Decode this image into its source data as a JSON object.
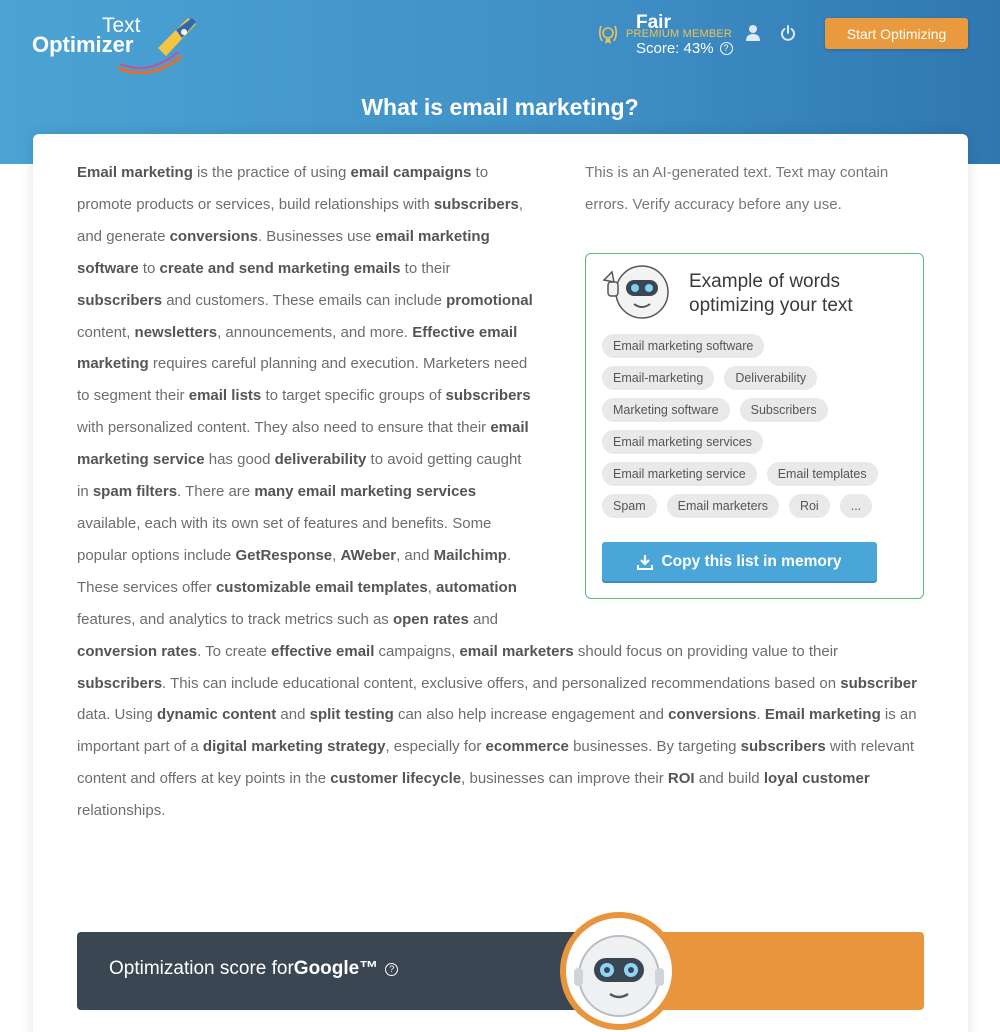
{
  "brand": {
    "logo_line1": "Text",
    "logo_line2": "Optimizer"
  },
  "header": {
    "premium_label": "PREMIUM MEMBER",
    "icons": [
      "medal-icon",
      "user-icon",
      "power-icon"
    ],
    "start_button": "Start Optimizing"
  },
  "page_title": "What is email marketing?",
  "disclaimer": "This is an AI-generated text. Text may contain errors. Verify accuracy before any use.",
  "article": {
    "segments": [
      {
        "t": "Email marketing",
        "b": true
      },
      {
        "t": " is the practice of using "
      },
      {
        "t": "email campaigns",
        "b": true
      },
      {
        "t": " to promote products or services, build relationships with "
      },
      {
        "t": "subscribers",
        "b": true
      },
      {
        "t": ", and generate "
      },
      {
        "t": "conversions",
        "b": true
      },
      {
        "t": ". Businesses use "
      },
      {
        "t": "email marketing software",
        "b": true
      },
      {
        "t": " to "
      },
      {
        "t": "create and send marketing emails",
        "b": true
      },
      {
        "t": " to their "
      },
      {
        "t": "subscribers",
        "b": true
      },
      {
        "t": " and customers. These emails can include "
      },
      {
        "t": "promotional",
        "b": true
      },
      {
        "t": " content, "
      },
      {
        "t": "newsletters",
        "b": true
      },
      {
        "t": ", announcements, and more. "
      },
      {
        "t": "Effective email marketing",
        "b": true
      },
      {
        "t": " requires careful planning and execution. Marketers need to segment their "
      },
      {
        "t": "email lists",
        "b": true
      },
      {
        "t": " to target specific groups of "
      },
      {
        "t": "subscribers",
        "b": true
      },
      {
        "t": " with personalized content. They also need to ensure that their "
      },
      {
        "t": "email marketing service",
        "b": true
      },
      {
        "t": " has good "
      },
      {
        "t": "deliverability",
        "b": true
      },
      {
        "t": " to avoid getting caught in "
      },
      {
        "t": "spam filters",
        "b": true
      },
      {
        "t": ". There are "
      },
      {
        "t": "many email marketing services",
        "b": true
      },
      {
        "t": " available, each with its own set of features and benefits. Some popular options include "
      },
      {
        "t": "GetResponse",
        "b": true
      },
      {
        "t": ", "
      },
      {
        "t": "AWeber",
        "b": true
      },
      {
        "t": ", and "
      },
      {
        "t": "Mailchimp",
        "b": true
      },
      {
        "t": ". These services offer "
      },
      {
        "t": "customizable email templates",
        "b": true
      },
      {
        "t": ", "
      },
      {
        "t": "automation",
        "b": true
      },
      {
        "t": " features, and analytics to track metrics such as "
      },
      {
        "t": "open rates",
        "b": true
      },
      {
        "t": " and "
      },
      {
        "t": "conversion rates",
        "b": true
      },
      {
        "t": ". To create "
      },
      {
        "t": "effective email",
        "b": true
      },
      {
        "t": " campaigns, "
      },
      {
        "t": "email marketers",
        "b": true
      },
      {
        "t": " should focus on providing value to their "
      },
      {
        "t": "subscribers",
        "b": true
      },
      {
        "t": ". This can include educational content, exclusive offers, and personalized recommendations based on "
      },
      {
        "t": "subscriber",
        "b": true
      },
      {
        "t": " data. Using "
      },
      {
        "t": "dynamic content",
        "b": true
      },
      {
        "t": " and "
      },
      {
        "t": "split testing",
        "b": true
      },
      {
        "t": " can also help increase engagement and "
      },
      {
        "t": "conversions",
        "b": true
      },
      {
        "t": ". "
      },
      {
        "t": "Email marketing",
        "b": true
      },
      {
        "t": " is an important part of a "
      },
      {
        "t": "digital marketing strategy",
        "b": true
      },
      {
        "t": ", especially for "
      },
      {
        "t": "ecommerce",
        "b": true
      },
      {
        "t": " businesses. By targeting "
      },
      {
        "t": "subscribers",
        "b": true
      },
      {
        "t": " with relevant content and offers at key points in the "
      },
      {
        "t": "customer lifecycle",
        "b": true
      },
      {
        "t": ", businesses can improve their "
      },
      {
        "t": "ROI",
        "b": true
      },
      {
        "t": " and build "
      },
      {
        "t": "loyal customer",
        "b": true
      },
      {
        "t": " relationships."
      }
    ]
  },
  "words_box": {
    "title": "Example of words optimizing your text",
    "rows": [
      [
        "Email marketing software"
      ],
      [
        "Email-marketing",
        "Deliverability"
      ],
      [
        "Marketing software",
        "Subscribers"
      ],
      [
        "Email marketing services"
      ],
      [
        "Email marketing service",
        "Email templates"
      ],
      [
        "Spam",
        "Email marketers",
        "Roi",
        "..."
      ]
    ],
    "copy_button": "Copy this list in memory"
  },
  "score": {
    "label_prefix": "Optimization score for ",
    "engine": "Google™",
    "grade": "Fair",
    "score_text": "Score: 43%",
    "score_value": 43,
    "colors": {
      "left": "#3b4653",
      "right": "#e9953d"
    }
  },
  "colors": {
    "header_from": "#4ba3d3",
    "header_to": "#2f77b0",
    "accent_orange": "#ea9a3e",
    "accent_blue": "#4aa6d8",
    "box_border": "#5cba7d"
  }
}
